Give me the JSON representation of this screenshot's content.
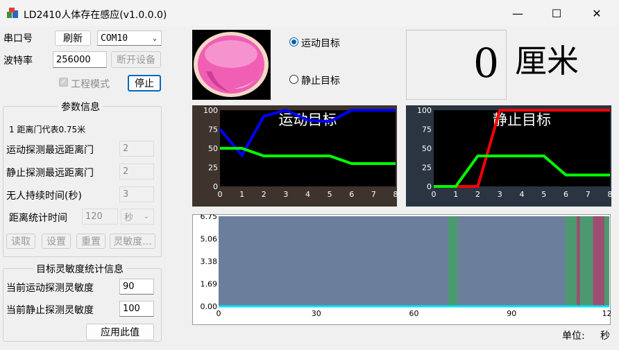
{
  "window": {
    "title": "LD2410人体存在感应(v1.0.0.0)",
    "minimize": "—",
    "maximize": "☐",
    "close": "✕"
  },
  "serial": {
    "port_label": "串口号",
    "refresh_label": "刷新",
    "port_value": "COM10",
    "baud_label": "波特率",
    "baud_value": "256000",
    "disconnect_label": "断开设备",
    "engineering_label": "工程模式",
    "engineering_checked": true,
    "stop_label": "停止"
  },
  "params": {
    "title": "参数信息",
    "gate_note": "1 距离门代表0.75米",
    "rows": [
      {
        "label": "运动探测最远距离门",
        "value": "2"
      },
      {
        "label": "静止探测最远距离门",
        "value": "2"
      },
      {
        "label": "无人持续时间(秒)",
        "value": "3"
      }
    ],
    "stat_time_label": "距离统计时间",
    "stat_time_value": "120",
    "stat_unit": "秒",
    "buttons": [
      "读取",
      "设置",
      "重置",
      "灵敏度..."
    ]
  },
  "sensitivity": {
    "title": "目标灵敏度统计信息",
    "motion_label": "当前运动探测灵敏度",
    "motion_value": "90",
    "static_label": "当前静止探测灵敏度",
    "static_value": "100",
    "apply_label": "应用此值"
  },
  "target": {
    "motion_label": "运动目标",
    "static_label": "静止目标",
    "selected": "motion"
  },
  "distance": {
    "value": "0",
    "unit": "厘米"
  },
  "footer": {
    "unit_label": "单位:",
    "unit_value": "秒"
  },
  "colors": {
    "motion_line": "#0000ff",
    "static_line": "#ff0000",
    "threshold_line": "#00ff00",
    "timeline_bg": "#6b7f9c",
    "timeline_green": "#4c9970",
    "timeline_red": "#9c4e70",
    "timeline_baseline": "#00e5ff"
  },
  "chart_data": [
    {
      "type": "line",
      "title": "运动目标",
      "x": [
        0,
        1,
        2,
        3,
        4,
        5,
        6,
        7,
        8
      ],
      "xlim": [
        0,
        8
      ],
      "ylim": [
        0,
        100
      ],
      "yticks": [
        0,
        25,
        50,
        75,
        100
      ],
      "series": [
        {
          "values": [
            75,
            41,
            92,
            100,
            87,
            85,
            100,
            100,
            100
          ],
          "color": "#0000ff"
        },
        {
          "values": [
            50,
            50,
            40,
            40,
            40,
            40,
            30,
            30,
            30
          ],
          "color": "#00ff00"
        }
      ]
    },
    {
      "type": "line",
      "title": "静止目标",
      "x": [
        0,
        1,
        2,
        3,
        4,
        5,
        6,
        7,
        8
      ],
      "xlim": [
        0,
        8
      ],
      "ylim": [
        0,
        100
      ],
      "yticks": [
        0,
        25,
        50,
        75,
        100
      ],
      "series": [
        {
          "values": [
            0,
            0,
            0,
            100,
            100,
            100,
            100,
            100,
            100
          ],
          "color": "#ff0000"
        },
        {
          "values": [
            0,
            0,
            40,
            40,
            40,
            40,
            15,
            15,
            15
          ],
          "color": "#00ff00"
        }
      ]
    },
    {
      "type": "area",
      "xlim": [
        0,
        120
      ],
      "ylim": [
        0,
        6.75
      ],
      "xticks": [
        0,
        30,
        60,
        90,
        120
      ],
      "yticks": [
        "0.00",
        "1.69",
        "3.38",
        "5.06",
        "6.75"
      ],
      "bands": [
        {
          "from": 70.5,
          "to": 73.5,
          "state": "motion"
        },
        {
          "from": 106.5,
          "to": 110,
          "state": "motion"
        },
        {
          "from": 110,
          "to": 111,
          "state": "static"
        },
        {
          "from": 111,
          "to": 115,
          "state": "motion"
        },
        {
          "from": 115,
          "to": 118.5,
          "state": "static"
        },
        {
          "from": 118.5,
          "to": 120,
          "state": "motion"
        }
      ],
      "baseline_value": 0.0
    }
  ]
}
